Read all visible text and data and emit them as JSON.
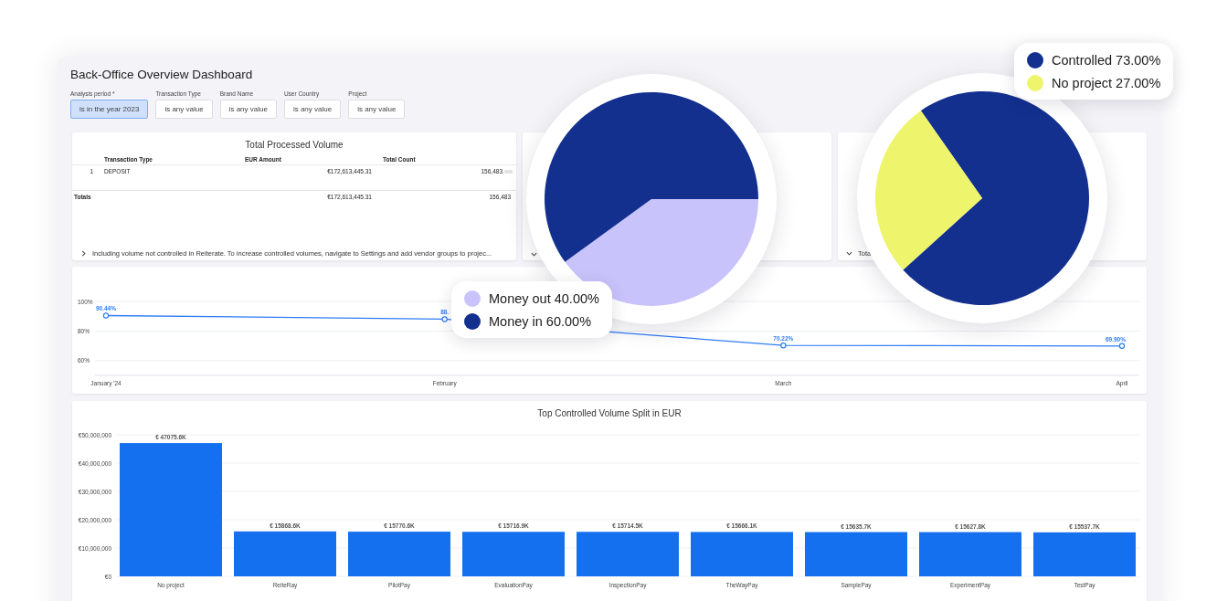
{
  "dashboard": {
    "title": "Back-Office Overview Dashboard"
  },
  "filters": [
    {
      "label": "Analysis period *",
      "value": "is in the year 2023",
      "highlighted": true
    },
    {
      "label": "Transaction Type",
      "value": "is any value",
      "highlighted": false
    },
    {
      "label": "Brand Name",
      "value": "is any value",
      "highlighted": false
    },
    {
      "label": "User Country",
      "value": "is any value",
      "highlighted": false
    },
    {
      "label": "Project",
      "value": "is any value",
      "highlighted": false
    }
  ],
  "volume_table": {
    "title": "Total Processed Volume",
    "columns": [
      "Transaction Type",
      "EUR Amount",
      "Total Count"
    ],
    "rows": [
      {
        "index": "1",
        "transaction_type": "DEPOSIT",
        "eur_amount": "€172,613,445.31",
        "total_count": "156,483"
      }
    ],
    "totals": {
      "label": "Totals",
      "eur_amount": "€172,613,445.31",
      "total_count": "156,483"
    },
    "footer": {
      "expanded": false,
      "text": "Including volume not controlled in Reiterate. To increase controlled volumes, navigate to Settings and add vendor groups to projec..."
    }
  },
  "side_cards": [
    {
      "footer_expanded": true
    },
    {
      "footer_expanded": true,
      "footer_text": "Total"
    }
  ],
  "trend_chart": {
    "chart_data": {
      "type": "line",
      "categories": [
        "January '24",
        "February",
        "March",
        "April"
      ],
      "series": [
        {
          "color": "#2f7cf6",
          "marker": "circle",
          "values": [
            90.44,
            88,
            70.22,
            69.9
          ]
        }
      ],
      "grid": true,
      "ylim": [
        50,
        100
      ],
      "yticks": [
        {
          "value": 60,
          "label": "60%"
        },
        {
          "value": 80,
          "label": "80%"
        },
        {
          "value": 100,
          "label": "100%"
        }
      ],
      "value_labels": [
        "90.44%",
        "88.",
        "70.22%",
        "69.90%"
      ]
    }
  },
  "volume_split": {
    "title": "Top Controlled Volume Split in EUR",
    "chart_data": {
      "type": "bar",
      "categories": [
        "No project",
        "ReiteRay",
        "PilotPay",
        "EvaluationPay",
        "InspectionPay",
        "TheWayPay",
        "SamplePay",
        "ExperimentPay",
        "TestPay"
      ],
      "series": [
        {
          "color": "#1570ef",
          "values": [
            47075600,
            15868600,
            15770600,
            15716900,
            15714500,
            15666100,
            15635700,
            15627800,
            15537700
          ]
        }
      ],
      "ylim": [
        0,
        50000000
      ],
      "grid": true,
      "yticks": [
        {
          "value": 0,
          "label": "€0"
        },
        {
          "value": 10000000,
          "label": "€10,000,000"
        },
        {
          "value": 20000000,
          "label": "€20,000,000"
        },
        {
          "value": 30000000,
          "label": "€30,000,000"
        },
        {
          "value": 40000000,
          "label": "€40,000,000"
        },
        {
          "value": 50000000,
          "label": "€50,000,000"
        }
      ],
      "value_labels": [
        "€ 47075.6K",
        "€ 15868.6K",
        "€ 15770.6K",
        "€ 15716.9K",
        "€ 15714.5K",
        "€ 15666.1K",
        "€ 15635.7K",
        "€ 15627.8K",
        "€ 15537.7K"
      ]
    }
  },
  "pies": [
    {
      "chart_data": {
        "type": "pie",
        "categories": [
          "Money out",
          "Money in"
        ],
        "values": [
          40,
          60
        ]
      },
      "legend": [
        {
          "percent": "40.00%",
          "color": "#c9c3fb"
        },
        {
          "percent": "60.00%",
          "color": "#13308f"
        }
      ]
    },
    {
      "chart_data": {
        "type": "pie",
        "categories": [
          "Controlled",
          "No project"
        ],
        "values": [
          73,
          27
        ]
      },
      "legend": [
        {
          "percent": "73.00%",
          "color": "#13308f"
        },
        {
          "percent": "27.00%",
          "color": "#eef46b"
        }
      ]
    }
  ]
}
